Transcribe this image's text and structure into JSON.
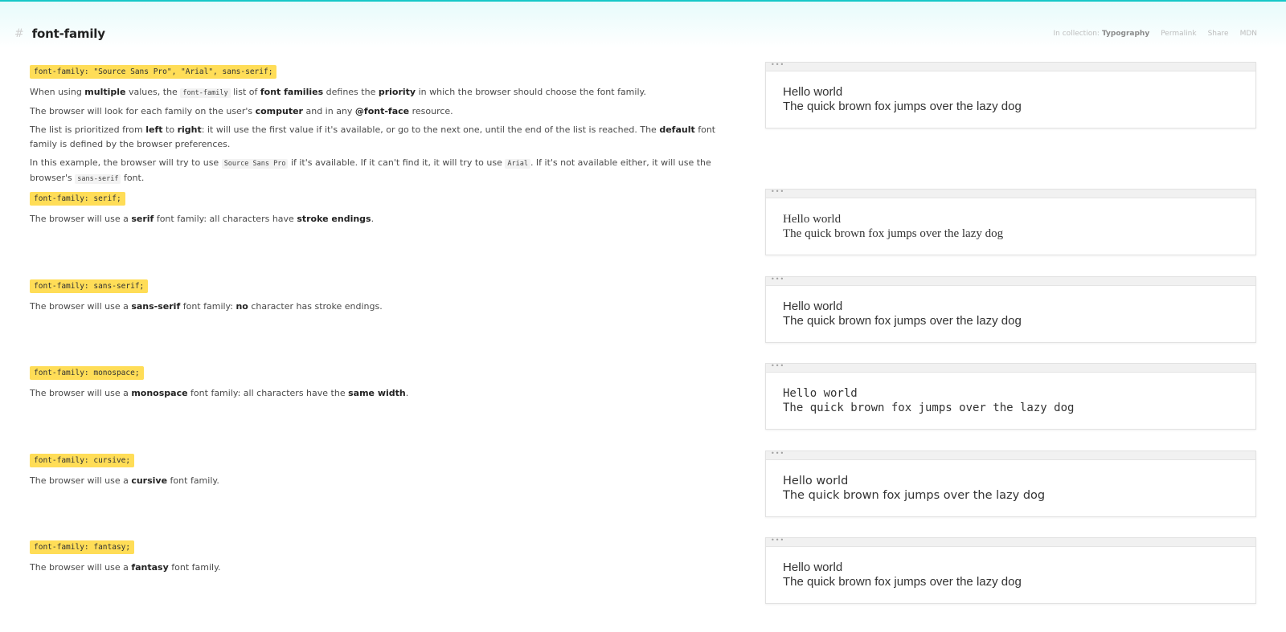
{
  "header": {
    "hash": "#",
    "title": "font-family",
    "collection_label": "In collection:",
    "collection_name": "Typography",
    "links": [
      "Permalink",
      "Share",
      "MDN"
    ]
  },
  "demo": {
    "toolbar": "•••",
    "line1": "Hello world",
    "line2": "The quick brown fox jumps over the lazy dog"
  },
  "sections": [
    {
      "code": "font-family: \"Source Sans Pro\", \"Arial\", sans-serif;",
      "paragraphs": [
        {
          "parts": [
            {
              "t": "When using "
            },
            {
              "t": "multiple",
              "b": true
            },
            {
              "t": " values, the "
            },
            {
              "t": "font-family",
              "c": true
            },
            {
              "t": " list of "
            },
            {
              "t": "font families",
              "b": true
            },
            {
              "t": " defines the "
            },
            {
              "t": "priority",
              "b": true
            },
            {
              "t": " in which the browser should choose the font family."
            }
          ]
        },
        {
          "parts": [
            {
              "t": "The browser will look for each family on the user's "
            },
            {
              "t": "computer",
              "b": true
            },
            {
              "t": " and in any "
            },
            {
              "t": "@font-face",
              "b": true
            },
            {
              "t": " resource."
            }
          ]
        },
        {
          "parts": [
            {
              "t": "The list is prioritized from "
            },
            {
              "t": "left",
              "b": true
            },
            {
              "t": " to "
            },
            {
              "t": "right",
              "b": true
            },
            {
              "t": ": it will use the first value if it's available, or go to the next one, until the end of the list is reached. The "
            },
            {
              "t": "default",
              "b": true
            },
            {
              "t": " font family is defined by the browser preferences."
            }
          ]
        },
        {
          "parts": [
            {
              "t": "In this example, the browser will try to use "
            },
            {
              "t": "Source Sans Pro",
              "c": true
            },
            {
              "t": " if it's available. If it can't find it, it will try to use "
            },
            {
              "t": "Arial",
              "c": true
            },
            {
              "t": ". If it's not available either, it will use the browser's "
            },
            {
              "t": "sans-serif",
              "c": true
            },
            {
              "t": " font."
            }
          ]
        }
      ]
    },
    {
      "code": "font-family: serif;",
      "paragraphs": [
        {
          "parts": [
            {
              "t": "The browser will use a "
            },
            {
              "t": "serif",
              "b": true
            },
            {
              "t": " font family: all characters have "
            },
            {
              "t": "stroke endings",
              "b": true
            },
            {
              "t": "."
            }
          ]
        }
      ]
    },
    {
      "code": "font-family: sans-serif;",
      "paragraphs": [
        {
          "parts": [
            {
              "t": "The browser will use a "
            },
            {
              "t": "sans-serif",
              "b": true
            },
            {
              "t": " font family: "
            },
            {
              "t": "no",
              "b": true
            },
            {
              "t": " character has stroke endings."
            }
          ]
        }
      ]
    },
    {
      "code": "font-family: monospace;",
      "paragraphs": [
        {
          "parts": [
            {
              "t": "The browser will use a "
            },
            {
              "t": "monospace",
              "b": true
            },
            {
              "t": " font family: all characters have the "
            },
            {
              "t": "same width",
              "b": true
            },
            {
              "t": "."
            }
          ]
        }
      ]
    },
    {
      "code": "font-family: cursive;",
      "paragraphs": [
        {
          "parts": [
            {
              "t": "The browser will use a "
            },
            {
              "t": "cursive",
              "b": true
            },
            {
              "t": " font family."
            }
          ]
        }
      ]
    },
    {
      "code": "font-family: fantasy;",
      "paragraphs": [
        {
          "parts": [
            {
              "t": "The browser will use a "
            },
            {
              "t": "fantasy",
              "b": true
            },
            {
              "t": " font family."
            }
          ]
        }
      ]
    }
  ]
}
